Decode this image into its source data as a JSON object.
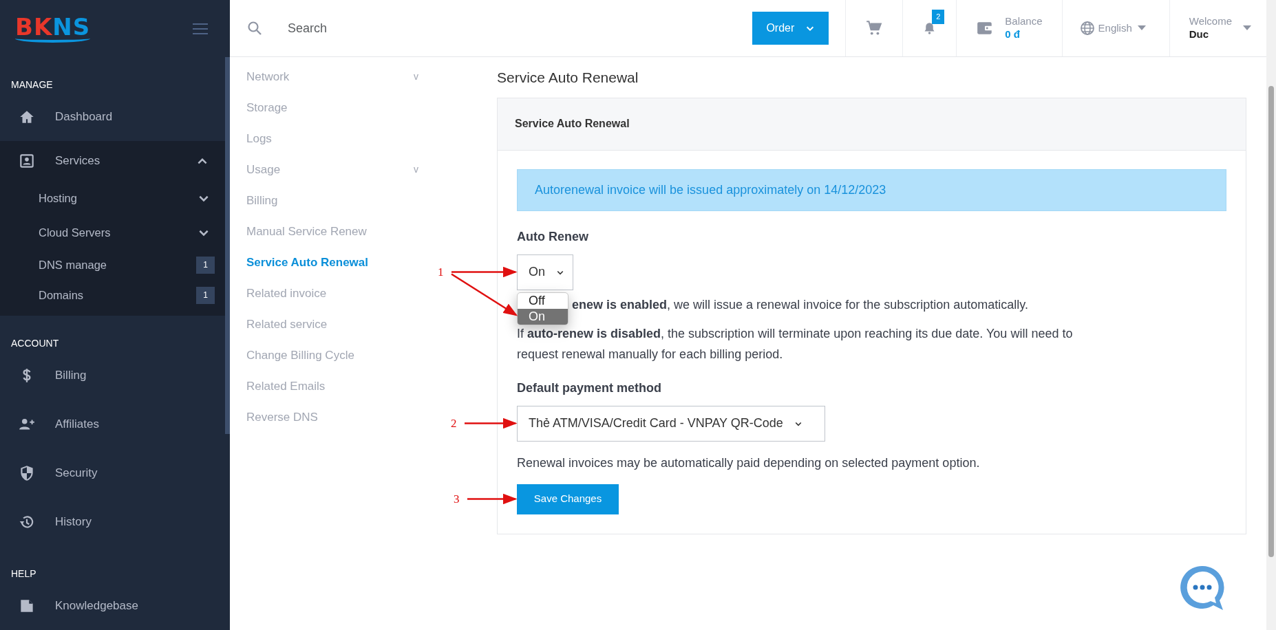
{
  "sidebar": {
    "logo": [
      {
        "text": "BK",
        "color": "#e8372a"
      },
      {
        "text": "NS",
        "color": "#0b95de"
      }
    ],
    "sections": [
      {
        "title": "MANAGE",
        "items": [
          {
            "label": "Dashboard"
          },
          {
            "label": "Services",
            "expanded": true,
            "children": [
              {
                "label": "Hosting",
                "expanded": false
              },
              {
                "label": "Cloud Servers",
                "expanded": false
              },
              {
                "label": "DNS manage",
                "badge": "1"
              },
              {
                "label": "Domains",
                "badge": "1"
              }
            ]
          }
        ]
      },
      {
        "title": "ACCOUNT",
        "items": [
          {
            "label": "Billing"
          },
          {
            "label": "Affiliates"
          },
          {
            "label": "Security"
          },
          {
            "label": "History"
          }
        ]
      },
      {
        "title": "HELP",
        "items": [
          {
            "label": "Knowledgebase"
          }
        ]
      }
    ]
  },
  "header": {
    "search": {
      "placeholder": "Search"
    },
    "order_button": "Order",
    "notifications": "2",
    "balance": {
      "label": "Balance",
      "value": "0 đ"
    },
    "language": "English",
    "user": {
      "greeting": "Welcome",
      "name": "Duc"
    }
  },
  "service_menu": [
    {
      "label": "Network",
      "caret": "v",
      "selected": false
    },
    {
      "label": "Storage",
      "selected": false
    },
    {
      "label": "Logs",
      "selected": false
    },
    {
      "label": "Usage",
      "caret": "v",
      "selected": false
    },
    {
      "label": "Billing",
      "selected": false
    },
    {
      "label": "Manual Service Renew",
      "selected": false
    },
    {
      "label": "Service Auto Renewal",
      "selected": true
    },
    {
      "label": "Related invoice",
      "selected": false
    },
    {
      "label": "Related service",
      "selected": false
    },
    {
      "label": "Change Billing Cycle",
      "selected": false
    },
    {
      "label": "Related Emails",
      "selected": false
    },
    {
      "label": "Reverse DNS",
      "selected": false
    }
  ],
  "page_title": "Service Auto Renewal",
  "card": {
    "title": "Service Auto Renewal",
    "alert": "Autorenewal invoice will be issued approximately on 14/12/2023",
    "auto_renew": {
      "label": "Auto Renew",
      "value": "On",
      "options": [
        {
          "label": "Off",
          "selected": false
        },
        {
          "label": "On",
          "selected": true
        }
      ]
    },
    "enabled_note": "**enew is enabled**, we will issue a renewal invoice for the subscription automatically.",
    "disabled_note": "If **auto-renew is disabled**, the subscription will terminate upon reaching its due date. You will need to request renewal manually for each billing period.",
    "payment": {
      "label": "Default payment method",
      "value": "Thẻ ATM/VISA/Credit Card - VNPAY QR-Code"
    },
    "payment_note": "Renewal invoices may be automatically paid depending on selected payment option.",
    "save_button": "Save Changes"
  },
  "annotations": [
    {
      "number": "1"
    },
    {
      "number": "2"
    },
    {
      "number": "3"
    }
  ]
}
